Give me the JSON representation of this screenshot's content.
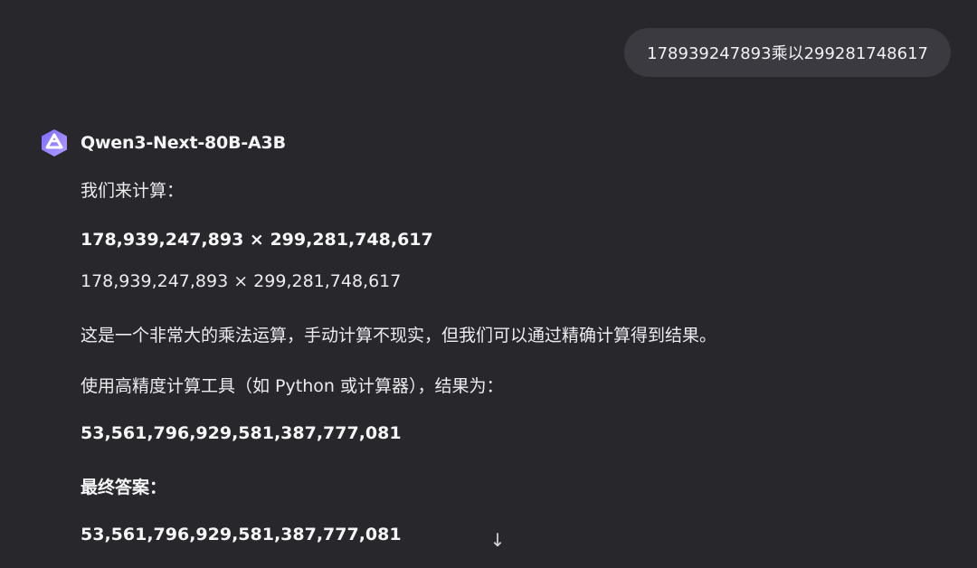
{
  "user_message": {
    "text": "178939247893乘以299281748617"
  },
  "assistant": {
    "model_name": "Qwen3-Next-80B-A3B",
    "avatar_icon": "qwen-logo-icon",
    "lines": [
      {
        "text": "我们来计算：",
        "bold": false
      },
      {
        "text": "178,939,247,893 × 299,281,748,617",
        "bold": true
      },
      {
        "text": "178,939,247,893 × 299,281,748,617",
        "bold": false
      },
      {
        "text": "这是一个非常大的乘法运算，手动计算不现实，但我们可以通过精确计算得到结果。",
        "bold": false
      },
      {
        "text": "使用高精度计算工具（如 Python 或计算器），结果为：",
        "bold": false
      },
      {
        "text": "53,561,796,929,581,387,777,081",
        "bold": true
      },
      {
        "text": "最终答案：",
        "bold": true
      },
      {
        "text": "53,561,796,929,581,387,777,081",
        "bold": true
      }
    ]
  },
  "scroll_button": {
    "icon": "arrow-down-icon",
    "glyph": "↓"
  },
  "colors": {
    "background": "#28272c",
    "user_bubble": "#3b3a40",
    "logo_gradient_start": "#6b5cff",
    "logo_gradient_end": "#a98bff"
  }
}
